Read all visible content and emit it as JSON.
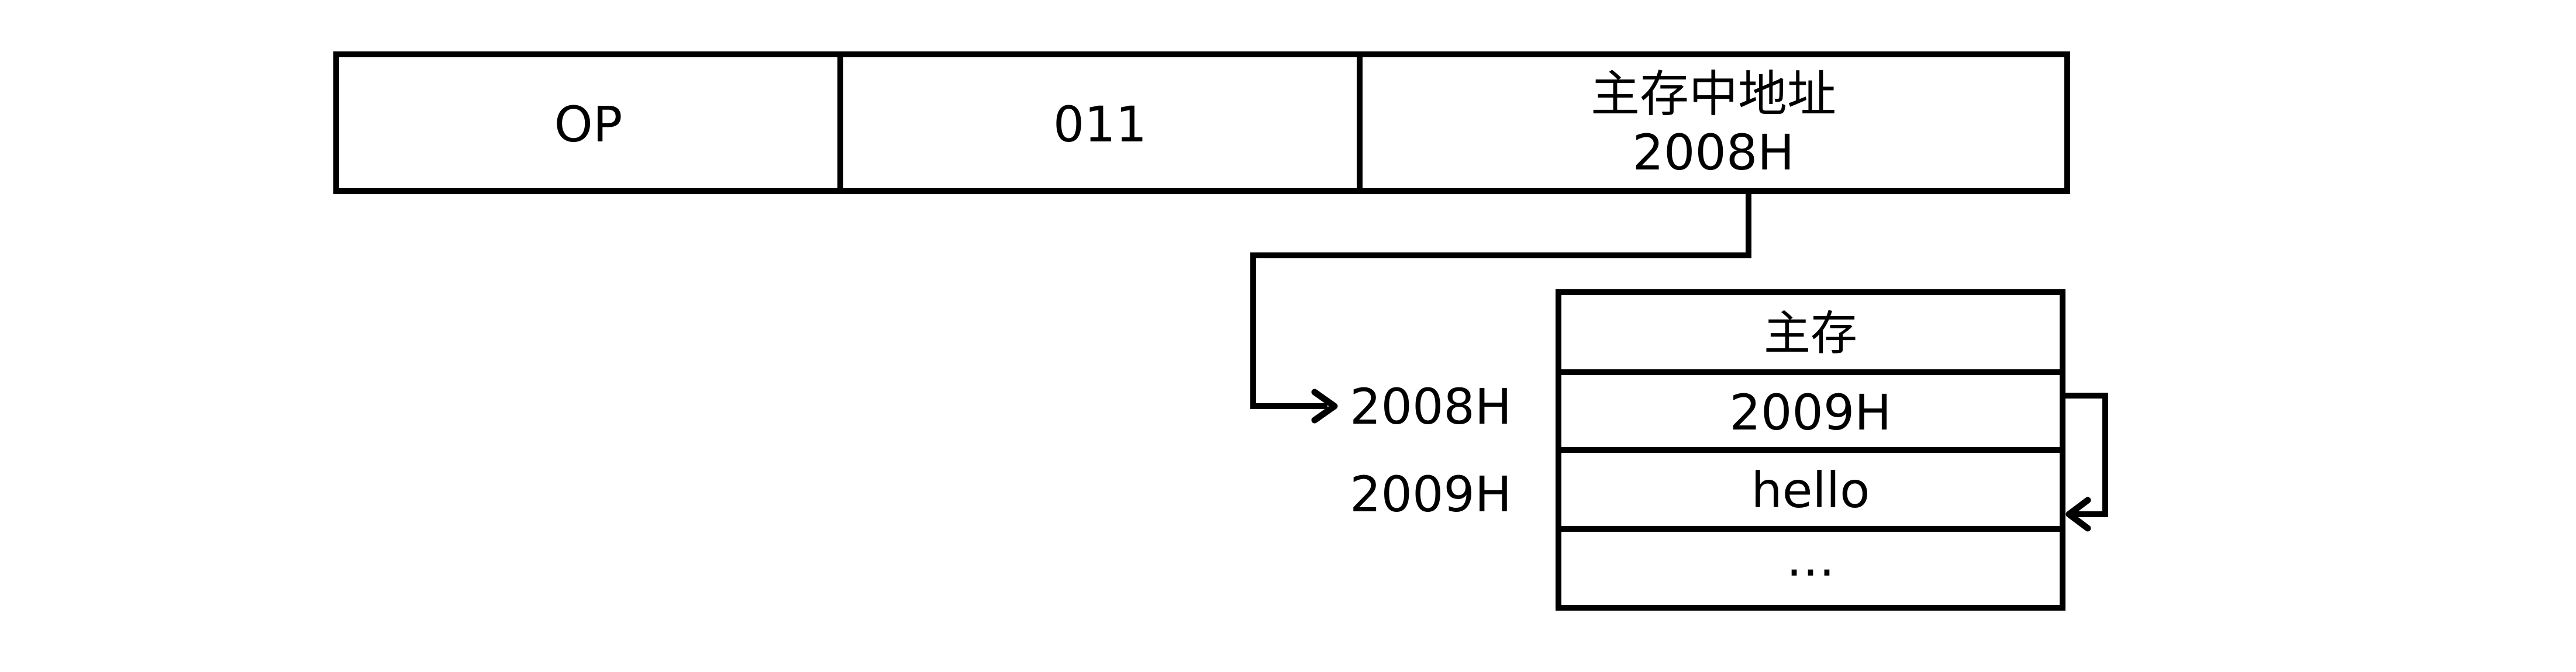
{
  "instruction": {
    "op": "OP",
    "mode": "011",
    "address_title": "主存中地址",
    "address_value": "2008H"
  },
  "memory": {
    "title": "主存",
    "rows": [
      {
        "address": "2008H",
        "content": "2009H"
      },
      {
        "address": "2009H",
        "content": "hello"
      },
      {
        "address": "",
        "content": "…"
      }
    ]
  }
}
